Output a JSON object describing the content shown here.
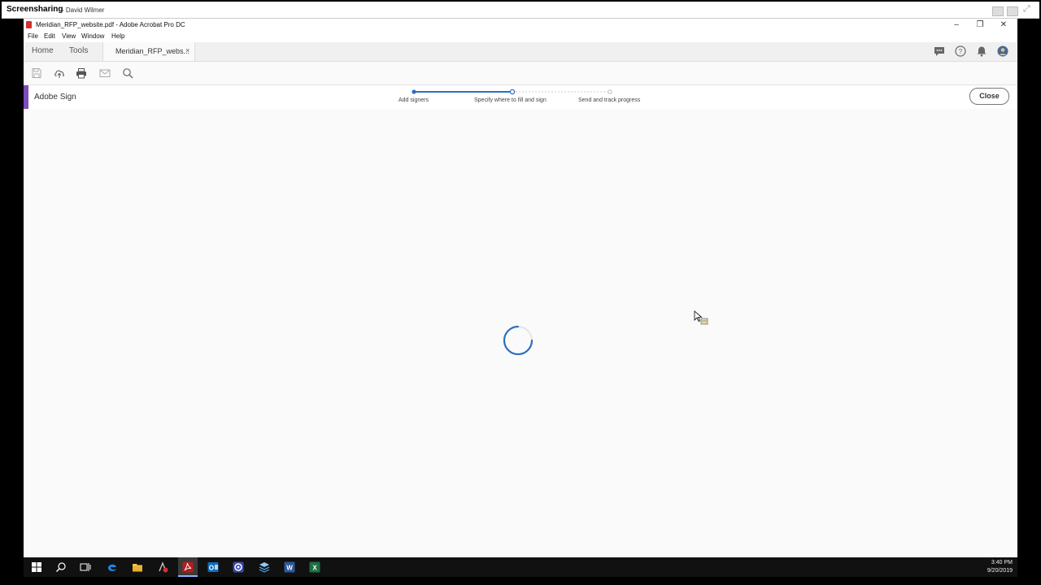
{
  "screenshare": {
    "title": "Screensharing",
    "subtitle": "- David Wilmer"
  },
  "window": {
    "title": "Meridian_RFP_website.pdf - Adobe Acrobat Pro DC"
  },
  "menu": [
    "File",
    "Edit",
    "View",
    "Window",
    "Help"
  ],
  "tabs": {
    "home": "Home",
    "tools": "Tools",
    "document": "Meridian_RFP_webs...",
    "close_glyph": "×"
  },
  "sign": {
    "title": "Adobe Sign",
    "steps": [
      "Add signers",
      "Specify where to fill and sign",
      "Send and track progress"
    ],
    "current_step": 2,
    "close_label": "Close"
  },
  "taskbar": {
    "time": "3:40 PM",
    "date": "9/20/2019"
  },
  "icons": {
    "window": [
      "pdf-file-icon",
      "minimize-icon",
      "restore-icon",
      "close-icon"
    ],
    "top": [
      "comment-icon",
      "help-icon",
      "bell-icon",
      "avatar-icon"
    ],
    "toolbar": [
      "save-icon",
      "upload-icon",
      "print-icon",
      "email-icon",
      "search-icon"
    ],
    "taskbar": [
      "start-icon",
      "search-icon",
      "task-view-icon",
      "edge-icon",
      "file-explorer-icon",
      "settings-icon",
      "acrobat-icon",
      "outlook-icon",
      "chrome-icon",
      "layers-icon",
      "word-icon",
      "excel-icon"
    ]
  },
  "colors": {
    "accent_purple": "#7c4dbc",
    "progress_blue": "#2d6fbd",
    "spinner_blue": "#2d6fbd"
  }
}
